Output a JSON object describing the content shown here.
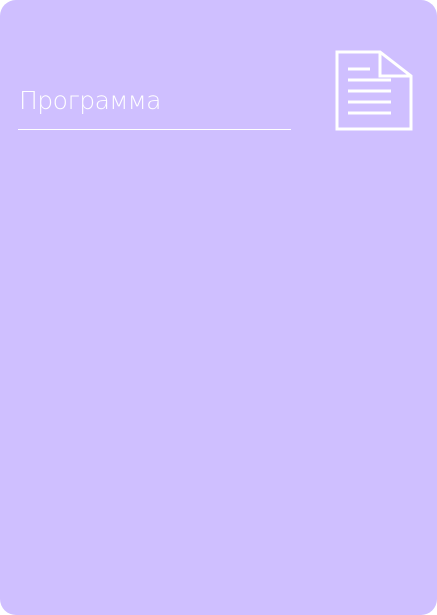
{
  "card": {
    "title": "Программа",
    "icon": "document-icon",
    "background_color": "#cfbfff",
    "foreground_color": "#ffffff"
  }
}
